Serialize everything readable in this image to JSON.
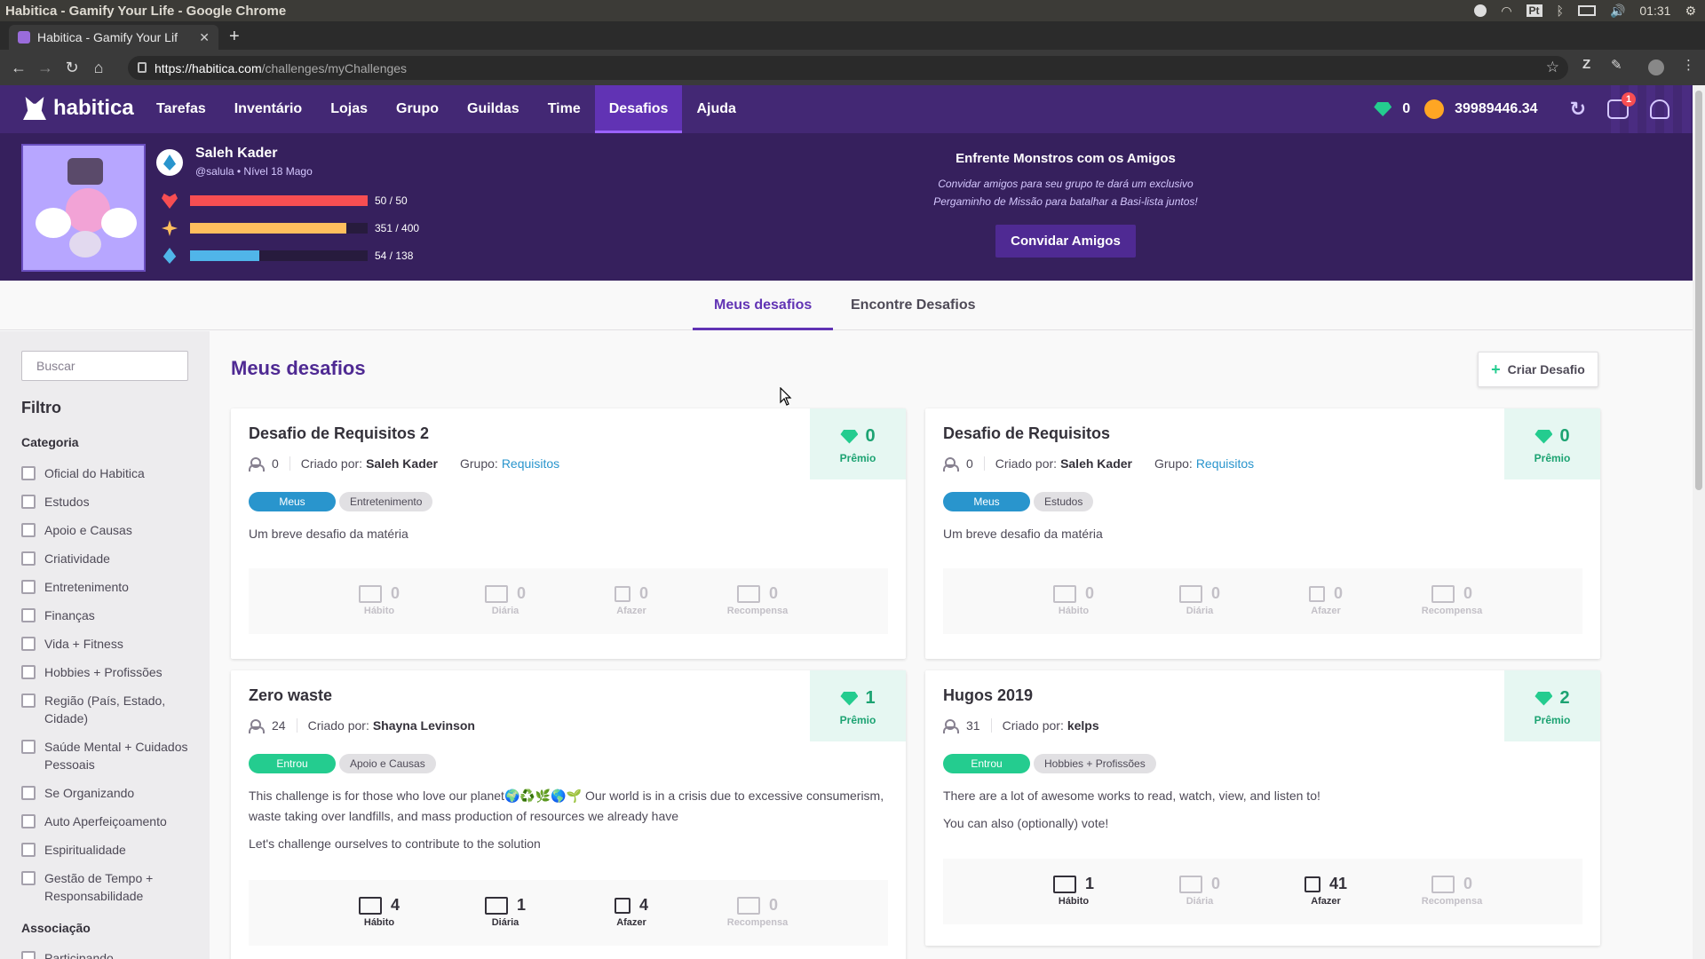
{
  "os": {
    "window_title": "Habitica - Gamify Your Life - Google Chrome",
    "lang": "Pt",
    "clock": "01:31"
  },
  "browser": {
    "tab_title": "Habitica - Gamify Your Lif",
    "url_host": "https://habitica.com",
    "url_path": "/challenges/myChallenges"
  },
  "nav": {
    "brand": "habitica",
    "items": [
      "Tarefas",
      "Inventário",
      "Lojas",
      "Grupo",
      "Guildas",
      "Time",
      "Desafios",
      "Ajuda"
    ],
    "gems": "0",
    "gold": "39989446.34",
    "notifications": "1"
  },
  "user": {
    "name": "Saleh Kader",
    "sub": "@salula • Nível 18 Mago",
    "hp": {
      "text": "50 / 50",
      "fraction": 1.0,
      "color": "#f74e52"
    },
    "xp": {
      "text": "351 / 400",
      "fraction": 0.8775,
      "color": "#ffbe5d"
    },
    "mp": {
      "text": "54 / 138",
      "fraction": 0.391,
      "color": "#50b5e9"
    }
  },
  "party": {
    "title": "Enfrente Monstros com os Amigos",
    "desc1": "Convidar amigos para seu grupo te dará um exclusivo",
    "desc2": "Pergaminho de Missão para batalhar a Basi-lista juntos!",
    "button": "Convidar Amigos"
  },
  "subtabs": [
    "Meus desafios",
    "Encontre Desafios"
  ],
  "sidebar": {
    "search_placeholder": "Buscar",
    "filter_title": "Filtro",
    "category_title": "Categoria",
    "categories": [
      "Oficial do Habitica",
      "Estudos",
      "Apoio e Causas",
      "Criatividade",
      "Entretenimento",
      "Finanças",
      "Vida + Fitness",
      "Hobbies + Profissões",
      "Região (País, Estado, Cidade)",
      "Saúde Mental + Cuidados Pessoais",
      "Se Organizando",
      "Auto Aperfeiçoamento",
      "Espiritualidade",
      "Gestão de Tempo + Responsabilidade"
    ],
    "membership_title": "Associação",
    "membership": [
      "Participando"
    ]
  },
  "main": {
    "title": "Meus desafios",
    "create_label": "Criar Desafio"
  },
  "labels": {
    "created_by": "Criado por:",
    "group": "Grupo:",
    "prize": "Prêmio",
    "habit": "Hábito",
    "daily": "Diária",
    "todo": "Afazer",
    "reward": "Recompensa"
  },
  "cards": [
    {
      "title": "Desafio de Requisitos 2",
      "members": "0",
      "creator": "Saleh Kader",
      "group": "Requisitos",
      "prize": "0",
      "status_tag": "Meus",
      "category_tag": "Entretenimento",
      "desc": [
        "Um breve desafio da matéria"
      ],
      "counts": {
        "habit": "0",
        "daily": "0",
        "todo": "0",
        "reward": "0"
      }
    },
    {
      "title": "Desafio de Requisitos",
      "members": "0",
      "creator": "Saleh Kader",
      "group": "Requisitos",
      "prize": "0",
      "status_tag": "Meus",
      "category_tag": "Estudos",
      "desc": [
        "Um breve desafio da matéria"
      ],
      "counts": {
        "habit": "0",
        "daily": "0",
        "todo": "0",
        "reward": "0"
      }
    },
    {
      "title": "Zero waste",
      "members": "24",
      "creator": "Shayna Levinson",
      "prize": "1",
      "status_tag": "Entrou",
      "category_tag": "Apoio e Causas",
      "desc": [
        "This challenge is for those who love our planet🌍♻️🌿🌎🌱 Our world is in a crisis due to excessive consumerism, waste taking over landfills, and mass production of resources we already have",
        "Let's challenge ourselves to contribute to the solution"
      ],
      "counts": {
        "habit": "4",
        "daily": "1",
        "todo": "4",
        "reward": "0"
      }
    },
    {
      "title": "Hugos 2019",
      "members": "31",
      "creator": "kelps",
      "prize": "2",
      "status_tag": "Entrou",
      "category_tag": "Hobbies + Profissões",
      "desc": [
        "There are a lot of awesome works to read, watch, view, and listen to!",
        "You can also (optionally) vote!"
      ],
      "counts": {
        "habit": "1",
        "daily": "0",
        "todo": "41",
        "reward": "0"
      }
    }
  ]
}
